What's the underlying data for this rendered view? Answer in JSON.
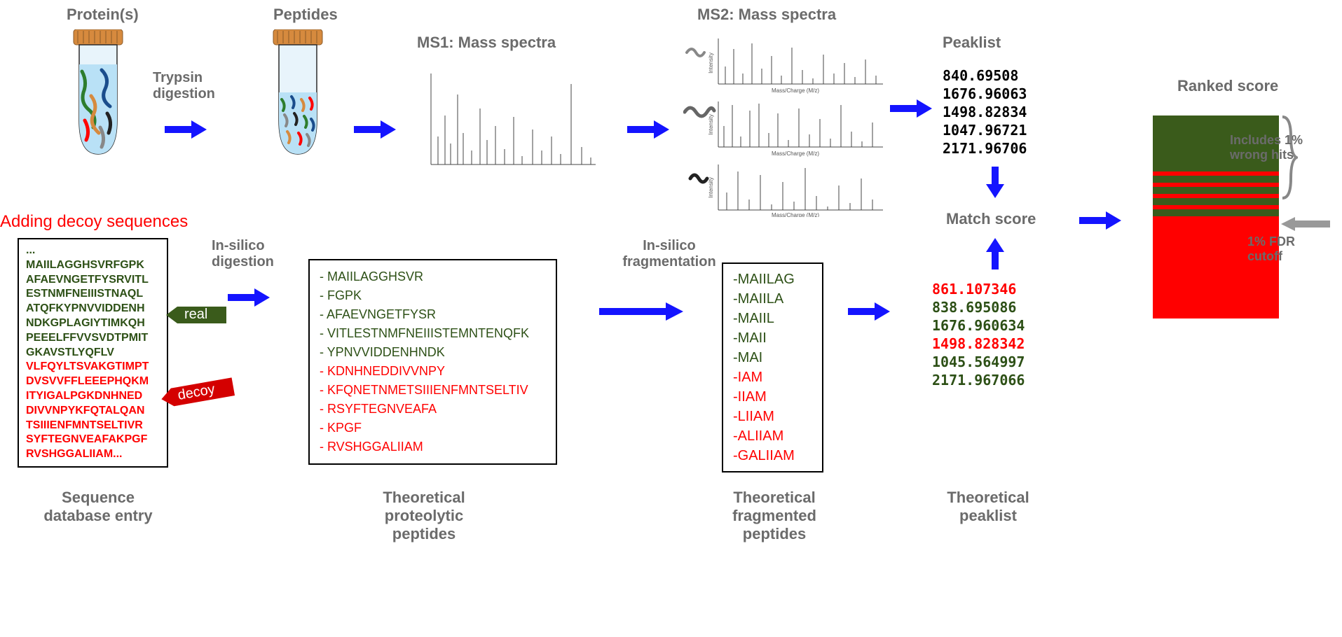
{
  "labels": {
    "proteins": "Protein(s)",
    "peptides": "Peptides",
    "trypsin": "Trypsin digestion",
    "ms1": "MS1: Mass spectra",
    "ms2": "MS2: Mass spectra",
    "peaklist": "Peaklist",
    "ranked": "Ranked score",
    "addingDecoy": "Adding decoy sequences",
    "insilicoDig": "In-silico digestion",
    "insilicoFrag": "In-silico fragmentation",
    "real": "real",
    "decoy": "decoy",
    "seqDb": "Sequence database entry",
    "theoProt": "Theoretical proteolytic peptides",
    "theoFrag": "Theoretical fragmented peptides",
    "theoPeak": "Theoretical peaklist",
    "matchScore": "Match score",
    "includes": "Includes 1% wrong hits",
    "fdr": "1% FDR cutoff"
  },
  "seqDbGreen": [
    "...",
    "MAIILAGGHSVRFGPK",
    "AFAEVNGETFYSRVITL",
    "ESTNMFNEIIISTNAQL",
    "ATQFKYPNVVIDDENH",
    "NDKGPLAGIYTIMKQH",
    "PEEELFFVVSVDTPMIT",
    "GKAVSTLYQFLV"
  ],
  "seqDbRed": [
    "VLFQYLTSVAKGTIMPT",
    "DVSVVFFLEEEPHQKM",
    "ITYIGALPGKDNHNED",
    "DIVVNPYKFQTALQAN",
    "TSIIIENFMNTSELTIVR",
    "SYFTEGNVEAFAKPGF",
    "RVSHGGALIIAM..."
  ],
  "theoPeptidesGreen": [
    "MAIILAGGHSVR",
    "FGPK",
    "AFAEVNGETFYSR",
    "VITLESTNMFNEIIISTEMNTENQFK",
    "YPNVVIDDENHNDK"
  ],
  "theoPeptidesRed": [
    "KDNHNEDDIVVNPY",
    "KFQNETNMETSIIIENFMNTSELTIV",
    "RSYFTEGNVEAFA",
    "KPGF",
    "RVSHGGALIIAM"
  ],
  "theoFragGreen": [
    "MAIILAG",
    "MAIILA",
    "MAIIL",
    "MAII",
    "MAI"
  ],
  "theoFragRed": [
    "IAM",
    "IIAM",
    "LIIAM",
    "ALIIAM",
    "GALIIAM"
  ],
  "expPeaklist": [
    "840.69508",
    "1676.96063",
    "1498.82834",
    "1047.96721",
    "2171.96706"
  ],
  "theoPeaklist": [
    {
      "v": "861.107346",
      "c": "red"
    },
    {
      "v": "838.695086",
      "c": "green"
    },
    {
      "v": "1676.960634",
      "c": "green"
    },
    {
      "v": "1498.828342",
      "c": "red"
    },
    {
      "v": "1045.564997",
      "c": "green"
    },
    {
      "v": "2171.967066",
      "c": "green"
    }
  ],
  "rankedBars": [
    {
      "h": 80,
      "c": "#3a5b1b"
    },
    {
      "h": 6,
      "c": "#ff0000"
    },
    {
      "h": 10,
      "c": "#3a5b1b"
    },
    {
      "h": 6,
      "c": "#ff0000"
    },
    {
      "h": 10,
      "c": "#3a5b1b"
    },
    {
      "h": 6,
      "c": "#ff0000"
    },
    {
      "h": 10,
      "c": "#3a5b1b"
    },
    {
      "h": 6,
      "c": "#ff0000"
    },
    {
      "h": 10,
      "c": "#3a5b1b"
    },
    {
      "h": 6,
      "c": "#ff0000"
    },
    {
      "h": 140,
      "c": "#ff0000"
    }
  ]
}
